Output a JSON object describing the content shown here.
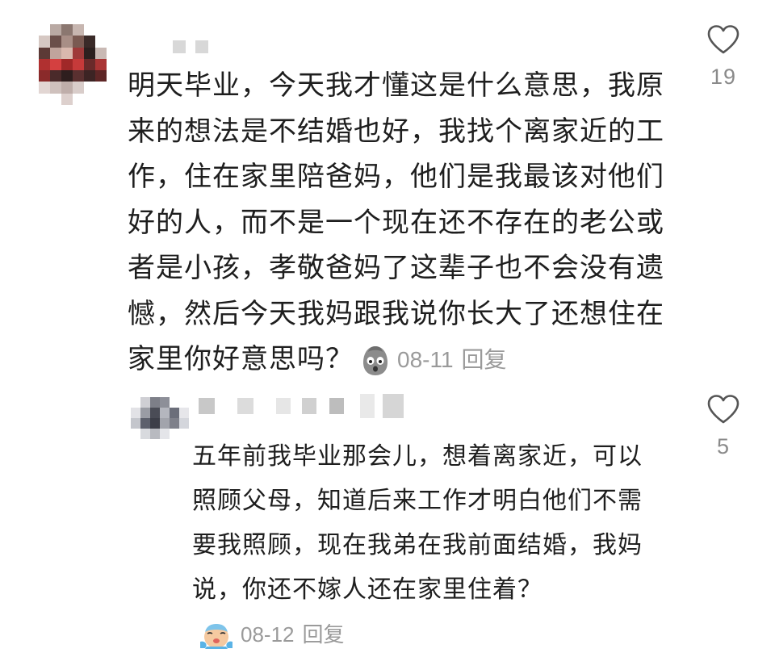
{
  "comments": [
    {
      "text": "明天毕业，今天我才懂这是什么意思，我原来的想法是不结婚也好，我找个离家近的工作，住在家里陪爸妈，他们是我最该对他们好的人，而不是一个现在还不存在的老公或者是小孩，孝敬爸妈了这辈子也不会没有遗憾，然后今天我妈跟我说你长大了还想住在家里你好意思吗？",
      "emoji": "grimacing-face-emoji",
      "date": "08-11",
      "reply_label": "回复",
      "likes": "19",
      "like_icon": "heart-outline-icon"
    },
    {
      "text": "五年前我毕业那会儿，想着离家近，可以照顾父母，知道后来工作才明白他们不需要我照顾，现在我弟在我前面结婚，我妈说，你还不嫁人还在家里住着？",
      "emoji": "crying-face-emoji",
      "date": "08-12",
      "reply_label": "回复",
      "likes": "5",
      "like_icon": "heart-outline-icon"
    }
  ],
  "colors": {
    "text": "#1e1e1e",
    "meta": "#9a9a9a",
    "like_count": "#8a8a8a",
    "icon": "#555555"
  }
}
